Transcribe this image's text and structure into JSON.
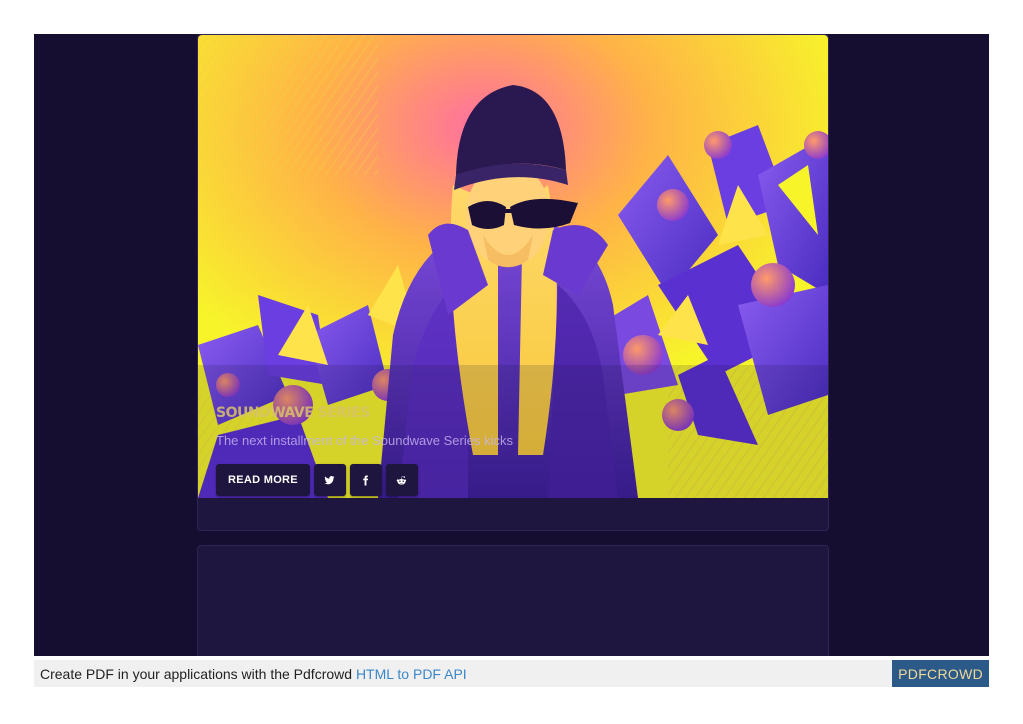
{
  "post": {
    "title": "Soundwave Series",
    "excerpt": "The next installment of the Soundwave Series kicks",
    "read_more_label": "READ MORE"
  },
  "share": {
    "twitter_icon": "twitter-icon",
    "facebook_icon": "facebook-icon",
    "reddit_icon": "reddit-icon"
  },
  "footer": {
    "text": "Create PDF in your applications with the Pdfcrowd",
    "link_text": "HTML to PDF API",
    "brand": "PDFCROWD"
  },
  "colors": {
    "background": "#160e30",
    "card": "#1f1640",
    "accent_yellow": "#f7f52a",
    "accent_purple": "#6a3ee0",
    "footer_brand": "#2b5a88"
  }
}
